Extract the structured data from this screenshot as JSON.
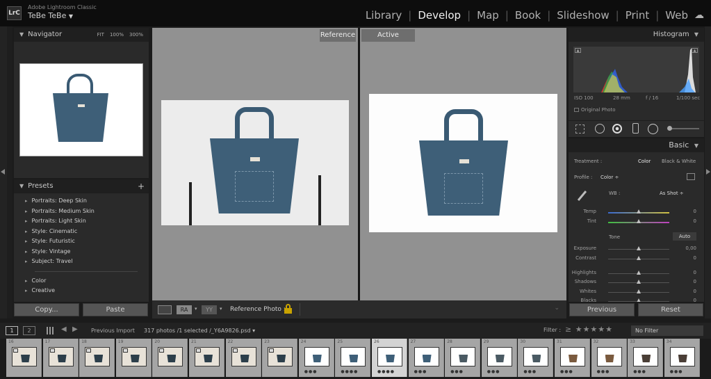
{
  "app": {
    "name": "Adobe Lightroom Classic",
    "logo": "LrC",
    "user": "TeBe TeBe"
  },
  "modules": [
    {
      "label": "Library",
      "active": false
    },
    {
      "label": "Develop",
      "active": true
    },
    {
      "label": "Map",
      "active": false
    },
    {
      "label": "Book",
      "active": false
    },
    {
      "label": "Slideshow",
      "active": false
    },
    {
      "label": "Print",
      "active": false
    },
    {
      "label": "Web",
      "active": false
    }
  ],
  "navigator": {
    "title": "Navigator",
    "zoom": [
      "FIT",
      "100%",
      "300%"
    ]
  },
  "presets": {
    "title": "Presets",
    "add": "+",
    "items": [
      "Portraits: Deep Skin",
      "Portraits: Medium Skin",
      "Portraits: Light Skin",
      "Style: Cinematic",
      "Style: Futuristic",
      "Style: Vintage",
      "Subject: Travel"
    ],
    "groups": [
      "Color",
      "Creative"
    ]
  },
  "left_buttons": {
    "copy": "Copy...",
    "paste": "Paste"
  },
  "compare": {
    "reference_label": "Reference",
    "active_label": "Active"
  },
  "toolbar": {
    "ref_photo_label": "Reference Photo :",
    "view_icons": [
      "RA",
      "YY"
    ]
  },
  "histogram": {
    "title": "Histogram",
    "iso": "ISO 100",
    "focal": "28 mm",
    "aperture": "f / 16",
    "shutter": "1/100 sec",
    "original_photo": "Original Photo"
  },
  "basic": {
    "title": "Basic",
    "treatment_label": "Treatment :",
    "treatment_color": "Color",
    "treatment_bw": "Black & White",
    "profile_label": "Profile :",
    "profile_value": "Color",
    "wb_label": "WB :",
    "wb_value": "As Shot",
    "tone_label": "Tone",
    "auto_label": "Auto",
    "sliders": [
      {
        "name": "Temp",
        "value": "0",
        "pos": 0.5
      },
      {
        "name": "Tint",
        "value": "0",
        "pos": 0.5
      },
      {
        "name": "Exposure",
        "value": "0,00",
        "pos": 0.5
      },
      {
        "name": "Contrast",
        "value": "0",
        "pos": 0.5
      },
      {
        "name": "Highlights",
        "value": "0",
        "pos": 0.5
      },
      {
        "name": "Shadows",
        "value": "0",
        "pos": 0.5
      },
      {
        "name": "Whites",
        "value": "0",
        "pos": 0.5
      },
      {
        "name": "Blacks",
        "value": "0",
        "pos": 0.5
      }
    ]
  },
  "right_buttons": {
    "previous": "Previous",
    "reset": "Reset"
  },
  "filmbar": {
    "pages": [
      "1",
      "2"
    ],
    "source": "Previous Import",
    "info": "317 photos /1 selected /_Y6A9826.psd",
    "filter_label": "Filter :",
    "filter_value": "No Filter"
  },
  "filmstrip": [
    {
      "n": "16",
      "stars": "",
      "kind": "stand"
    },
    {
      "n": "17",
      "stars": "",
      "kind": "stand"
    },
    {
      "n": "18",
      "stars": "",
      "kind": "stand"
    },
    {
      "n": "19",
      "stars": "",
      "kind": "stand"
    },
    {
      "n": "20",
      "stars": "",
      "kind": "stand"
    },
    {
      "n": "21",
      "stars": "",
      "kind": "stand"
    },
    {
      "n": "22",
      "stars": "",
      "kind": "stand"
    },
    {
      "n": "23",
      "stars": "",
      "kind": "stand"
    },
    {
      "n": "24",
      "stars": "●●●",
      "kind": "blue"
    },
    {
      "n": "25",
      "stars": "●●●●",
      "kind": "blue"
    },
    {
      "n": "26",
      "stars": "●●●●",
      "kind": "blue",
      "selected": true
    },
    {
      "n": "27",
      "stars": "●●●",
      "kind": "blue"
    },
    {
      "n": "28",
      "stars": "●●●",
      "kind": "grey"
    },
    {
      "n": "29",
      "stars": "●●●",
      "kind": "grey"
    },
    {
      "n": "30",
      "stars": "●●●",
      "kind": "grey"
    },
    {
      "n": "31",
      "stars": "●●●",
      "kind": "brown"
    },
    {
      "n": "32",
      "stars": "●●●",
      "kind": "brown"
    },
    {
      "n": "33",
      "stars": "●●●",
      "kind": "darkbrown"
    },
    {
      "n": "34",
      "stars": "●●●",
      "kind": "darkbrown"
    }
  ]
}
